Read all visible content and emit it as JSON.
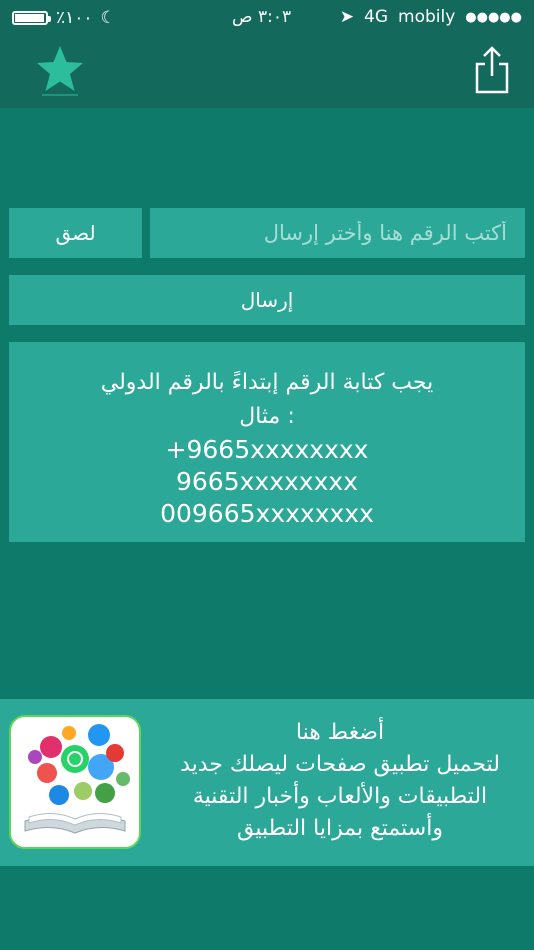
{
  "status_bar": {
    "battery": "٪١٠٠",
    "battery_level": 0.95,
    "time": "٣:٠٣ ص",
    "network": "4G",
    "carrier": "mobily",
    "signal_dots": "●●●●●"
  },
  "nav": {
    "favorite_icon": "star-icon",
    "share_icon": "share-icon"
  },
  "input": {
    "placeholder": "أكتب الرقم هنا وأختر إرسال",
    "value": ""
  },
  "buttons": {
    "paste": "لصق",
    "send": "إرسال"
  },
  "info": {
    "line1": "يجب كتابة الرقم إبتداءً بالرقم الدولي",
    "line2": "مثال :",
    "example1": "+9665xxxxxxxx",
    "example2": "9665xxxxxxxx",
    "example3": "009665xxxxxxxx"
  },
  "promo": {
    "title": "أضغط هنا",
    "line1": "لتحميل تطبيق صفحات ليصلك جديد",
    "line2": "التطبيقات والألعاب وأخبار التقنية",
    "line3": "وأستمتع بمزايا التطبيق",
    "image_icon": "app-book-icon"
  },
  "colors": {
    "background": "#0e7a6a",
    "bar": "#13695c",
    "panel": "#2ba898",
    "star": "#2bbd9c"
  }
}
